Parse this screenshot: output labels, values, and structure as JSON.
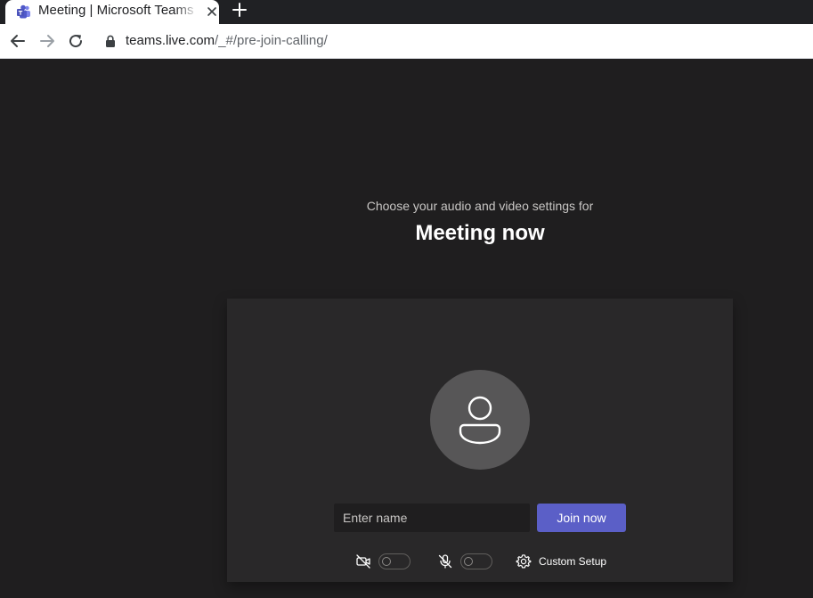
{
  "browser": {
    "tab_title": "Meeting | Microsoft Teams",
    "url_host": "teams.live.com",
    "url_path": "/_#/pre-join-calling/"
  },
  "prejoin": {
    "subtitle": "Choose your audio and video settings for",
    "meeting_title": "Meeting now",
    "name_placeholder": "Enter name",
    "name_value": "",
    "join_label": "Join now",
    "camera_on": false,
    "mic_on": false,
    "custom_setup_label": "Custom Setup"
  },
  "colors": {
    "brand": "#5b5fc7",
    "background": "#1f1e1f",
    "card": "#292829"
  }
}
